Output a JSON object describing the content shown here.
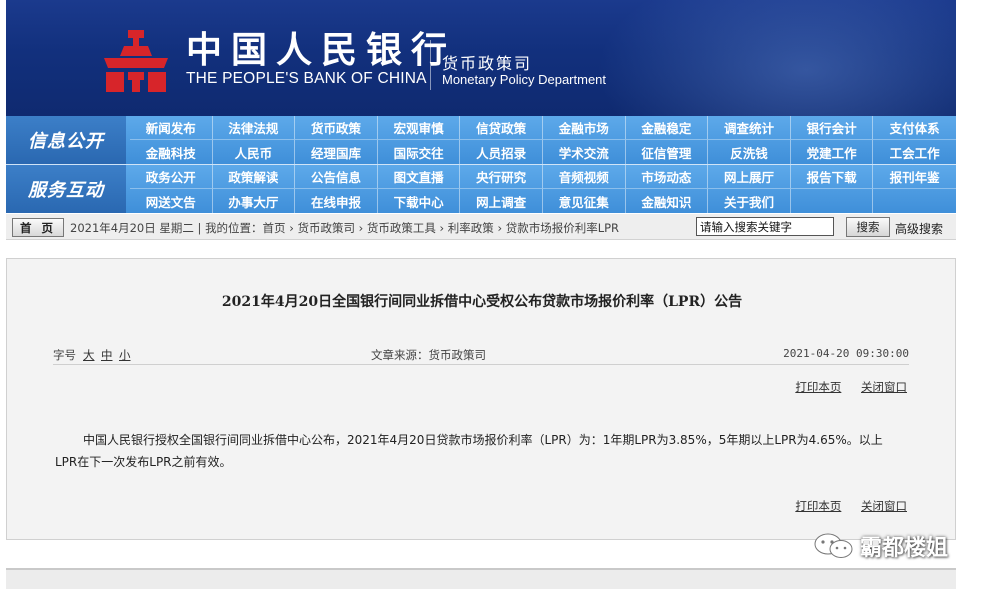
{
  "header": {
    "bank_name_cn": "中国人民银行",
    "bank_name_en": "THE PEOPLE'S BANK OF CHINA",
    "dept_cn": "货币政策司",
    "dept_en": "Monetary Policy Department",
    "brand_color": "#1b3a8d",
    "logo_color": "#d7252a"
  },
  "nav_info": {
    "label": "信息公开",
    "items": [
      "新闻发布",
      "法律法规",
      "货币政策",
      "宏观审慎",
      "信贷政策",
      "金融市场",
      "金融稳定",
      "调查统计",
      "银行会计",
      "支付体系",
      "金融科技",
      "人民币",
      "经理国库",
      "国际交往",
      "人员招录",
      "学术交流",
      "征信管理",
      "反洗钱",
      "党建工作",
      "工会工作"
    ]
  },
  "nav_service": {
    "label": "服务互动",
    "items": [
      "政务公开",
      "政策解读",
      "公告信息",
      "图文直播",
      "央行研究",
      "音频视频",
      "市场动态",
      "网上展厅",
      "报告下载",
      "报刊年鉴",
      "网送文告",
      "办事大厅",
      "在线申报",
      "下载中心",
      "网上调查",
      "意见征集",
      "金融知识",
      "关于我们",
      "",
      ""
    ]
  },
  "crumb_bar": {
    "home_label": "首 页",
    "date_text": "2021年4月20日 星期二",
    "location_text": "我的位置：首页 › 货币政策司 › 货币政策工具 › 利率政策 › 贷款市场报价利率LPR",
    "search_value": "请输入搜索关键字",
    "search_button": "搜索",
    "advanced_search": "高级搜索"
  },
  "article": {
    "title": "2021年4月20日全国银行间同业拆借中心受权公布贷款市场报价利率（LPR）公告",
    "font_size_label": "字号",
    "font_large": "大",
    "font_medium": "中",
    "font_small": "小",
    "source": "文章来源：货币政策司",
    "date": "2021-04-20 09:30:00",
    "print_label": "打印本页",
    "close_label": "关闭窗口",
    "body": "中国人民银行授权全国银行间同业拆借中心公布，2021年4月20日贷款市场报价利率（LPR）为：1年期LPR为3.85%，5年期以上LPR为4.65%。以上LPR在下一次发布LPR之前有效。"
  },
  "watermark": {
    "text": "霸都楼姐",
    "icon": "wechat-icon"
  }
}
